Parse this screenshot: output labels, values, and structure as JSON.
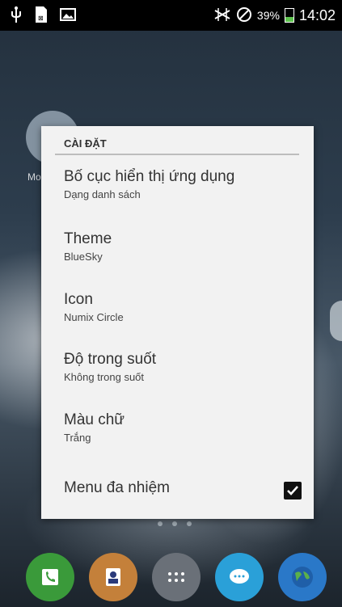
{
  "status_bar": {
    "battery_percent": "39%",
    "time": "14:02",
    "battery_level": 0.39,
    "icons": [
      "usb-icon",
      "sim-icon",
      "image-icon",
      "no-signal-icon",
      "do-not-disturb-icon",
      "battery-charging-icon"
    ]
  },
  "background": {
    "app_label": "Mo"
  },
  "dialog": {
    "title": "CÀI ĐẶT",
    "items": [
      {
        "title": "Bố cục hiển thị ứng dụng",
        "summary": "Dạng danh sách"
      },
      {
        "title": "Theme",
        "summary": "BlueSky"
      },
      {
        "title": "Icon",
        "summary": "Numix Circle"
      },
      {
        "title": "Độ trong suốt",
        "summary": "Không trong suốt"
      },
      {
        "title": "Màu chữ",
        "summary": "Trắng"
      }
    ],
    "checkbox_item": {
      "title": "Menu đa nhiệm",
      "checked": true
    }
  },
  "dock": {
    "icons": [
      "phone-icon",
      "contacts-icon",
      "apps-icon",
      "messages-icon",
      "browser-icon"
    ]
  },
  "colors": {
    "battery_fill": "#5ec34e",
    "dialog_bg": "#f2f2f2"
  }
}
